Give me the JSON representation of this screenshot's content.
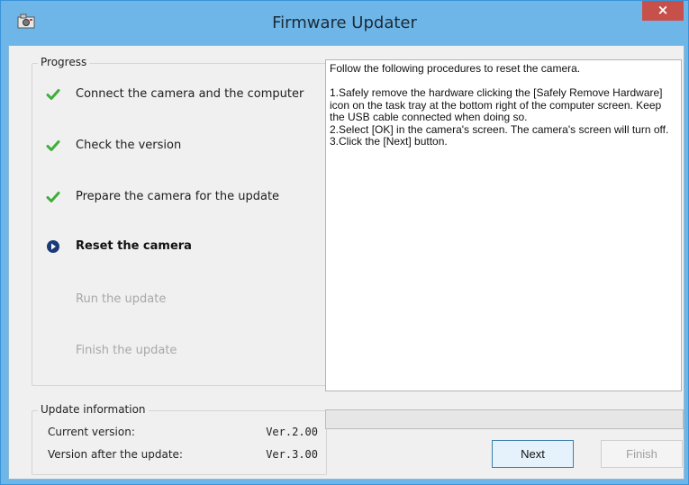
{
  "window": {
    "title": "Firmware Updater",
    "close_glyph": "×",
    "accent_color": "#6fb6e8"
  },
  "progress": {
    "label": "Progress",
    "steps": [
      {
        "label": "Connect the camera and the computer",
        "state": "done",
        "icon": "check-icon"
      },
      {
        "label": "Check the version",
        "state": "done",
        "icon": "check-icon"
      },
      {
        "label": "Prepare the camera for the update",
        "state": "done",
        "icon": "check-icon"
      },
      {
        "label": "Reset the camera",
        "state": "current",
        "icon": "arrow-circle-icon"
      },
      {
        "label": "Run the update",
        "state": "pending",
        "icon": ""
      },
      {
        "label": "Finish the update",
        "state": "pending",
        "icon": ""
      }
    ]
  },
  "instructions": {
    "lines": [
      "Follow the following procedures to reset the camera.",
      "",
      "1.Safely remove the hardware clicking the [Safely Remove Hardware] icon on the task tray at the bottom right of the computer screen. Keep the USB cable connected when doing so.",
      "2.Select [OK] in the camera's screen. The camera's screen will turn off.",
      "3.Click the [Next] button."
    ]
  },
  "update_info": {
    "label": "Update information",
    "current_label": "Current version:",
    "current_value": "Ver.2.00",
    "after_label": "Version after the update:",
    "after_value": "Ver.3.00"
  },
  "progress_bar": {
    "value": 0
  },
  "buttons": {
    "next": "Next",
    "finish": "Finish"
  }
}
